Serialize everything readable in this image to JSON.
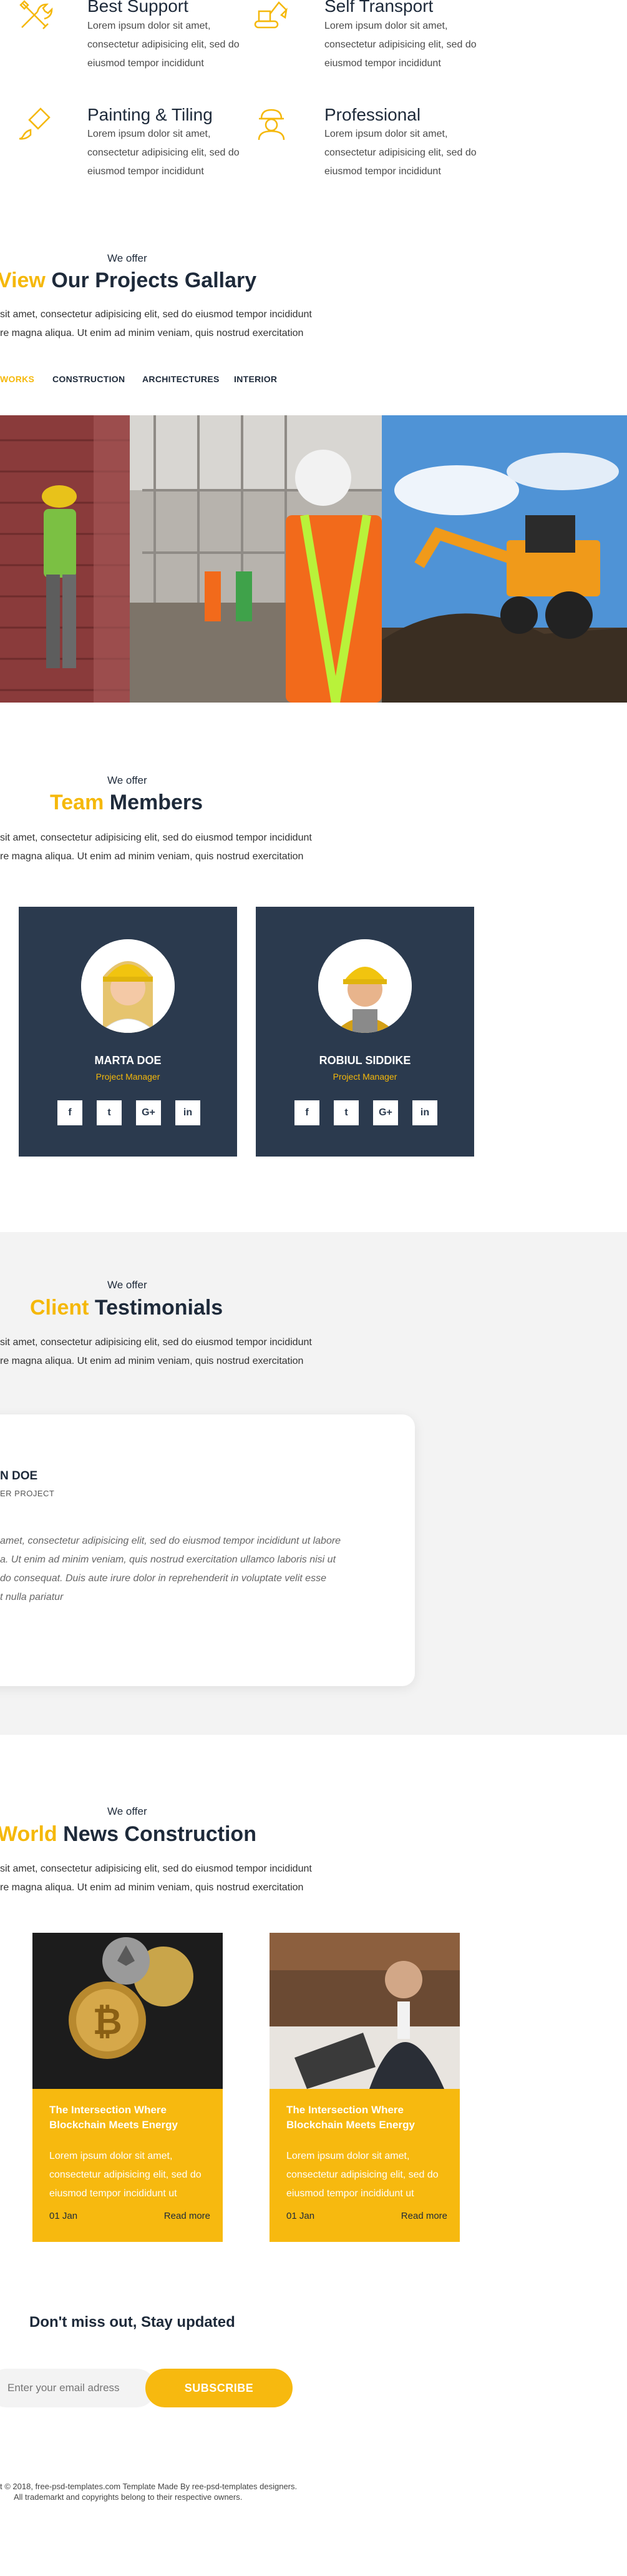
{
  "features": [
    {
      "title": "Best Support",
      "icon": "tools-icon",
      "text": "Lorem ipsum dolor sit amet, consectetur adipisicing elit, sed do eiusmod tempor incididunt"
    },
    {
      "title": "Self Transport",
      "icon": "excavator-icon",
      "text": "Lorem ipsum dolor sit amet, consectetur adipisicing elit, sed do eiusmod tempor incididunt"
    },
    {
      "title": "Painting &  Tiling",
      "icon": "paint-brush-icon",
      "text": "Lorem ipsum dolor sit amet, consectetur adipisicing elit, sed do eiusmod tempor incididunt"
    },
    {
      "title": "Professional",
      "icon": "worker-icon",
      "text": "Lorem ipsum dolor sit amet, consectetur adipisicing elit, sed do eiusmod tempor incididunt"
    }
  ],
  "projects": {
    "kicker": "We offer",
    "title_accent": "View",
    "title_rest": "Our Projects Gallary",
    "desc_line1": "sit amet, consectetur adipisicing elit, sed do eiusmod tempor incididunt",
    "desc_line2": "re magna aliqua. Ut enim ad minim veniam, quis nostrud exercitation",
    "filters": [
      "WORKS",
      "CONSTRUCTION",
      "ARCHITECTURES",
      "INTERIOR"
    ]
  },
  "team": {
    "kicker": "We offer",
    "title_accent": "Team",
    "title_rest": "Members",
    "desc_line1": "sit amet, consectetur adipisicing elit, sed do eiusmod tempor incididunt",
    "desc_line2": "re magna aliqua. Ut enim ad minim veniam, quis nostrud exercitation",
    "members": [
      {
        "name": "MARTA DOE",
        "role": "Project Manager"
      },
      {
        "name": "ROBIUL SIDDIKE",
        "role": "Project Manager"
      }
    ],
    "social": [
      "f",
      "t",
      "G+",
      "in"
    ]
  },
  "testimonials": {
    "kicker": "We offer",
    "title_accent": "Client",
    "title_rest": "Testimonials",
    "desc_line1": "sit amet, consectetur adipisicing elit, sed do eiusmod tempor incididunt",
    "desc_line2": "re magna aliqua. Ut enim ad minim veniam, quis nostrud exercitation",
    "name": "N DOE",
    "role": "ER PROJECT",
    "quote_lines": [
      "amet, consectetur adipisicing elit, sed do eiusmod tempor incididunt ut labore",
      "a. Ut enim ad minim veniam, quis nostrud exercitation ullamco laboris nisi ut",
      "do consequat. Duis aute irure dolor in reprehenderit in voluptate velit esse",
      "t nulla pariatur"
    ]
  },
  "news": {
    "kicker": "We offer",
    "title_accent": "World",
    "title_rest": "News Construction",
    "desc_line1": "sit amet, consectetur adipisicing elit, sed do eiusmod tempor incididunt",
    "desc_line2": "re magna aliqua. Ut enim ad minim veniam, quis nostrud exercitation",
    "posts": [
      {
        "title": "The Intersection Where Blockchain Meets Energy",
        "text": "Lorem ipsum dolor sit amet, consectetur adipisicing elit, sed do eiusmod tempor incididunt ut",
        "date": "01 Jan",
        "more": "Read more"
      },
      {
        "title": "The Intersection Where Blockchain Meets Energy",
        "text": "Lorem ipsum dolor sit amet, consectetur adipisicing elit, sed do eiusmod tempor incididunt ut",
        "date": "01 Jan",
        "more": "Read more"
      }
    ]
  },
  "newsletter": {
    "title": "Don't miss out, Stay updated",
    "placeholder": "Enter your email adress",
    "button": "SUBSCRIBE"
  },
  "footer": {
    "line1": "t © 2018, free-psd-templates.com Template Made By ree-psd-templates designers.",
    "line2": "All trademarkt and copyrights belong to their respective owners."
  },
  "colors": {
    "accent": "#f5b80a",
    "navy": "#2b3a4e"
  }
}
